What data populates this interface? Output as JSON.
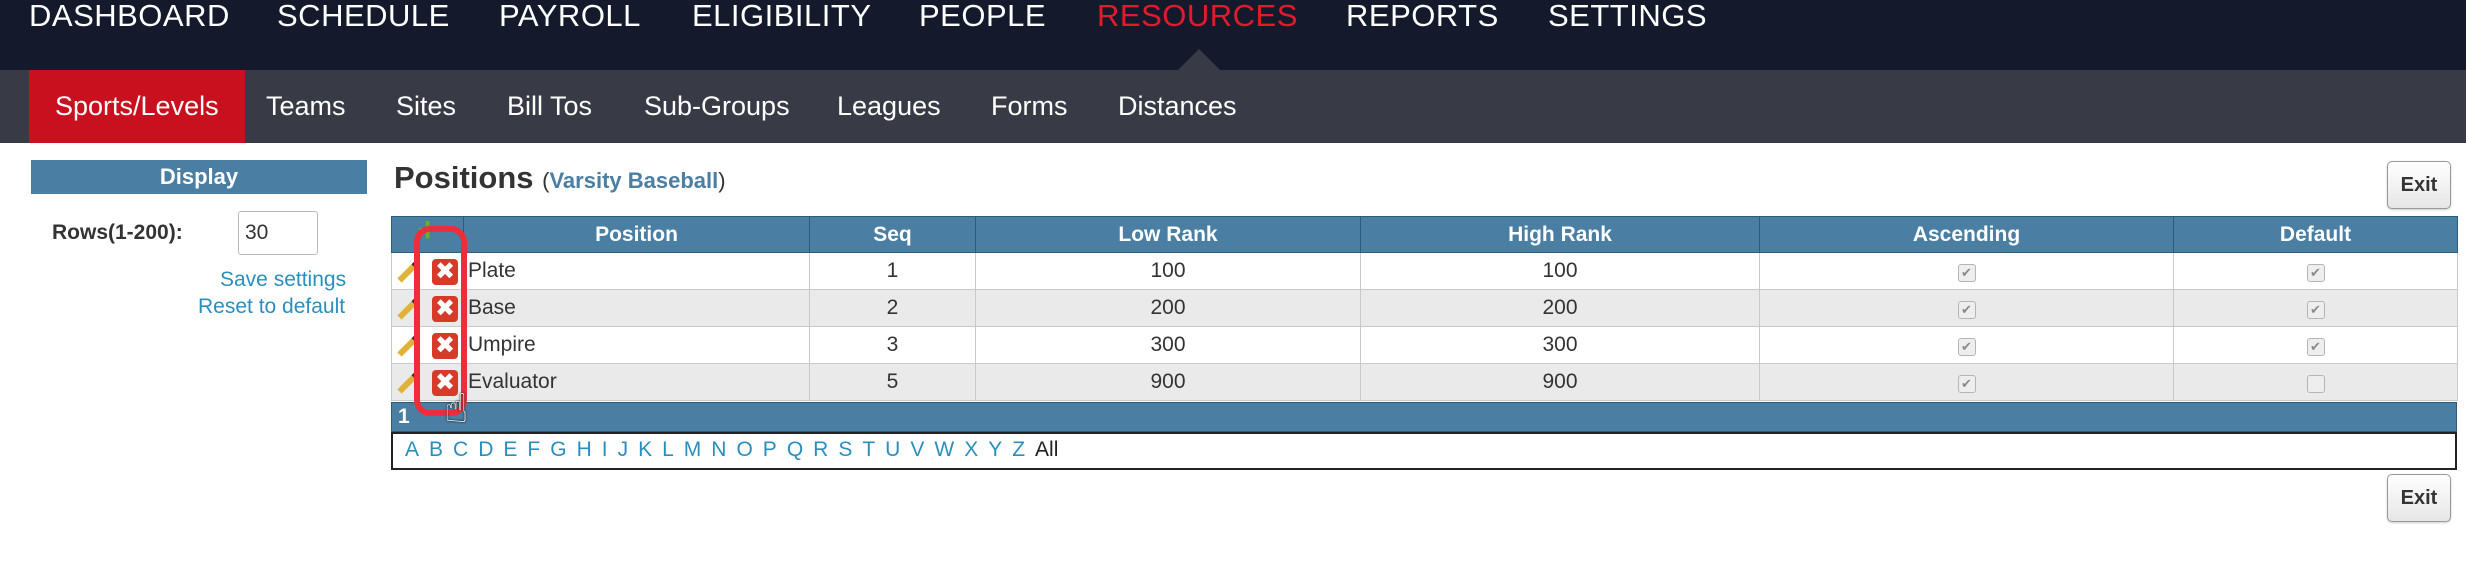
{
  "top_nav": {
    "items": [
      "DASHBOARD",
      "SCHEDULE",
      "PAYROLL",
      "ELIGIBILITY",
      "PEOPLE",
      "RESOURCES",
      "REPORTS",
      "SETTINGS"
    ],
    "active": "RESOURCES"
  },
  "sub_nav": {
    "items": [
      "Sports/Levels",
      "Teams",
      "Sites",
      "Bill Tos",
      "Sub-Groups",
      "Leagues",
      "Forms",
      "Distances"
    ],
    "active": "Sports/Levels"
  },
  "display_panel": {
    "header": "Display",
    "rows_label": "Rows(1-200):",
    "rows_value": "30",
    "save_link": "Save settings",
    "reset_link": "Reset to default"
  },
  "page": {
    "title": "Positions",
    "subtitle_open": "(",
    "subtitle": "Varsity Baseball",
    "subtitle_close": ")",
    "exit_label": "Exit"
  },
  "table": {
    "columns": [
      "Position",
      "Seq",
      "Low Rank",
      "High Rank",
      "Ascending",
      "Default"
    ],
    "rows": [
      {
        "position": "Plate",
        "seq": "1",
        "low": "100",
        "high": "100",
        "ascending": true,
        "default": true
      },
      {
        "position": "Base",
        "seq": "2",
        "low": "200",
        "high": "200",
        "ascending": true,
        "default": true
      },
      {
        "position": "Umpire",
        "seq": "3",
        "low": "300",
        "high": "300",
        "ascending": true,
        "default": true
      },
      {
        "position": "Evaluator",
        "seq": "5",
        "low": "900",
        "high": "900",
        "ascending": true,
        "default": false
      }
    ]
  },
  "pager": {
    "page": "1"
  },
  "alpha_filter": {
    "letters": [
      "A",
      "B",
      "C",
      "D",
      "E",
      "F",
      "G",
      "H",
      "I",
      "J",
      "K",
      "L",
      "M",
      "N",
      "O",
      "P",
      "Q",
      "R",
      "S",
      "T",
      "U",
      "V",
      "W",
      "X",
      "Y",
      "Z"
    ],
    "all": "All"
  },
  "icons": {
    "add": "plus-icon",
    "edit": "pencil-icon",
    "delete": "delete-x-icon",
    "cursor": "hand-pointer-icon"
  },
  "colors": {
    "nav_bg": "#141a2c",
    "subnav_bg": "#383b46",
    "accent_red": "#c8101e",
    "header_blue": "#4a7ea3",
    "link_blue": "#2a8fbf",
    "highlight": "#ee2d3a"
  }
}
